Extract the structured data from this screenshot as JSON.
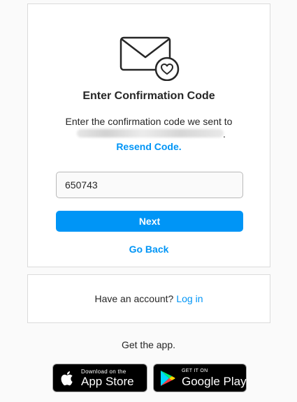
{
  "confirmation": {
    "title": "Enter Confirmation Code",
    "description": "Enter the confirmation code we sent to",
    "email_trailing": ".",
    "resend_label": "Resend Code.",
    "code_value": "650743",
    "next_label": "Next",
    "go_back_label": "Go Back"
  },
  "login_prompt": {
    "text": "Have an account?",
    "link_label": "Log in"
  },
  "get_app": {
    "text": "Get the app.",
    "app_store": {
      "small": "Download on the",
      "big": "App Store",
      "icon": "apple-icon"
    },
    "google_play": {
      "small": "GET IT ON",
      "big": "Google Play",
      "icon": "google-play-icon"
    }
  },
  "colors": {
    "accent": "#0095f6",
    "text": "#262626",
    "border": "#dbdbdb",
    "background": "#fafafa"
  }
}
